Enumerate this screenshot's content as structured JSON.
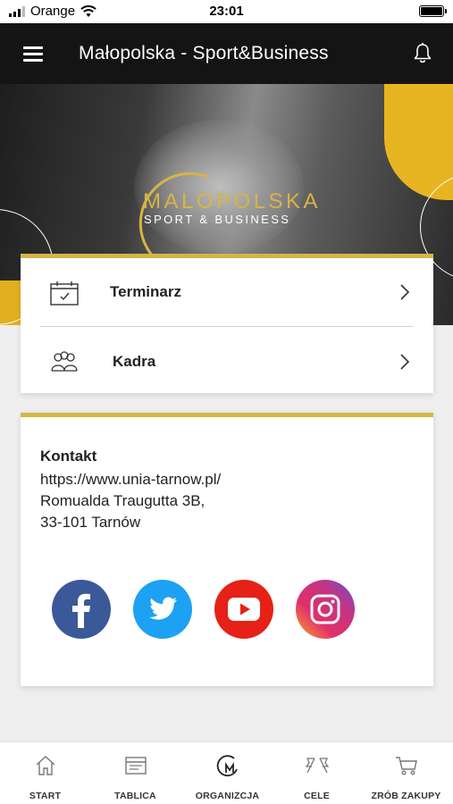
{
  "status_bar": {
    "carrier": "Orange",
    "time": "23:01"
  },
  "header": {
    "title": "Małopolska - Sport&Business"
  },
  "hero": {
    "logo_line1": "MALOPOLSKA",
    "logo_line2": "SPORT & BUSINESS"
  },
  "menu": {
    "items": [
      {
        "label": "Terminarz",
        "icon": "calendar-icon"
      },
      {
        "label": "Kadra",
        "icon": "team-icon"
      }
    ]
  },
  "contact": {
    "title": "Kontakt",
    "url": "https://www.unia-tarnow.pl/",
    "address_line1": "Romualda Traugutta 3B,",
    "address_line2": "33-101 Tarnów",
    "social": [
      {
        "name": "facebook-icon",
        "color": "#3b5998"
      },
      {
        "name": "twitter-icon",
        "color": "#1da1f2"
      },
      {
        "name": "youtube-icon",
        "color": "#e62117"
      },
      {
        "name": "instagram-icon",
        "color": "#c13584"
      }
    ]
  },
  "accent_color": "#d4b646",
  "bottom_nav": {
    "items": [
      {
        "label": "START",
        "icon": "home-icon"
      },
      {
        "label": "TABLICA",
        "icon": "board-icon"
      },
      {
        "label": "ORGANIZCJA",
        "icon": "organization-icon"
      },
      {
        "label": "CELE",
        "icon": "flags-icon"
      },
      {
        "label": "ZRÓB ZAKUPY",
        "icon": "cart-icon"
      }
    ]
  }
}
